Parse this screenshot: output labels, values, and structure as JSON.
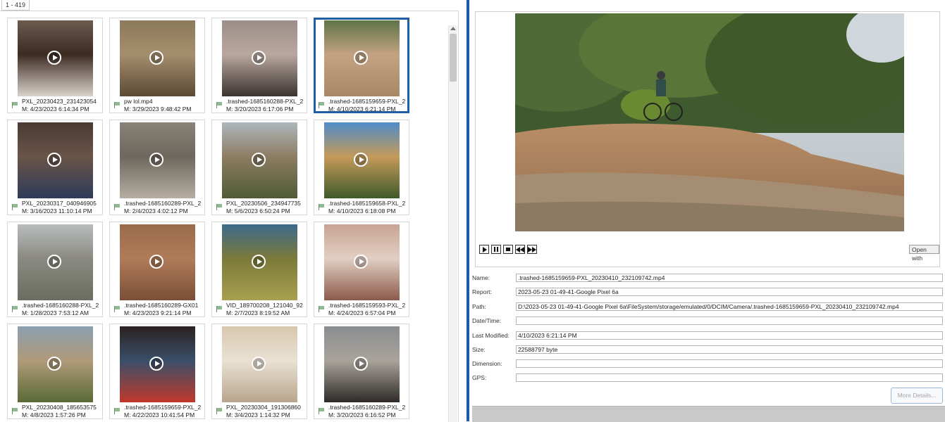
{
  "gallery": {
    "range_label": "1 - 419",
    "tiles": [
      {
        "name": "PXL_20230423_231423054",
        "date": "M: 4/23/2023 6:14:34 PM",
        "selected": false,
        "colors": [
          "#6b5a4e",
          "#d9d3cb",
          "#3d2b22"
        ]
      },
      {
        "name": "pw lol.mp4",
        "date": "M: 3/29/2023 9:48:42 PM",
        "selected": false,
        "colors": [
          "#8c7a5a",
          "#5c4a35",
          "#a58e6e"
        ]
      },
      {
        "name": ".trashed-1685160288-PXL_2",
        "date": "M: 3/20/2023 6:17:06 PM",
        "selected": false,
        "colors": [
          "#9c8f88",
          "#3b3330",
          "#b8a79e"
        ]
      },
      {
        "name": ".trashed-1685159659-PXL_2",
        "date": "M: 4/10/2023 6:21:14 PM",
        "selected": true,
        "colors": [
          "#5f7347",
          "#a78766",
          "#c4a383"
        ]
      },
      {
        "name": "PXL_20230317_040946905",
        "date": "M: 3/16/2023 11:10:14 PM",
        "selected": false,
        "colors": [
          "#4a3a33",
          "#2f3b5a",
          "#6a5448"
        ]
      },
      {
        "name": ".trashed-1685160289-PXL_2",
        "date": "M: 2/4/2023 4:02:12 PM",
        "selected": false,
        "colors": [
          "#8a8377",
          "#b5aea1",
          "#6d675d"
        ]
      },
      {
        "name": "PXL_20230506_234947735",
        "date": "M: 5/6/2023 6:50:24 PM",
        "selected": false,
        "colors": [
          "#aeb6bd",
          "#4f5a35",
          "#8c7d62"
        ]
      },
      {
        "name": ".trashed-1685159658-PXL_2",
        "date": "M: 4/10/2023 6:18:08 PM",
        "selected": false,
        "colors": [
          "#4f8cc9",
          "#3e5a2a",
          "#c59a5a"
        ]
      },
      {
        "name": ".trashed-1685160288-PXL_2",
        "date": "M: 1/28/2023 7:53:12 AM",
        "selected": false,
        "colors": [
          "#b9bcbd",
          "#6a6d5f",
          "#8a8a82"
        ]
      },
      {
        "name": ".trashed-1685160289-GX01",
        "date": "M: 4/23/2023 9:21:14 PM",
        "selected": false,
        "colors": [
          "#9a6b4b",
          "#7a4f37",
          "#b07c58"
        ]
      },
      {
        "name": "VID_189700208_121040_92",
        "date": "M: 2/7/2023 8:19:52 AM",
        "selected": false,
        "colors": [
          "#3c6a8a",
          "#a7a14f",
          "#7c7a3a"
        ]
      },
      {
        "name": ".trashed-1685159593-PXL_2",
        "date": "M: 4/24/2023 6:57:04 PM",
        "selected": false,
        "colors": [
          "#c8a393",
          "#8a5a4a",
          "#e2cfc3"
        ]
      },
      {
        "name": "PXL_20230408_185653575",
        "date": "M: 4/8/2023 1:57:26 PM",
        "selected": false,
        "colors": [
          "#8aa0b0",
          "#5a6a35",
          "#b09a7a"
        ]
      },
      {
        "name": ".trashed-1685159659-PXL_2",
        "date": "M: 4/22/2023 10:41:54 PM",
        "selected": false,
        "colors": [
          "#2a2220",
          "#c0392b",
          "#3a4f6a"
        ]
      },
      {
        "name": "PXL_20230304_191306860",
        "date": "M: 3/4/2023 1:14:32 PM",
        "selected": false,
        "colors": [
          "#d8c7ae",
          "#b9a58d",
          "#e9e1d4"
        ]
      },
      {
        "name": ".trashed-1685160289-PXL_2",
        "date": "M: 3/20/2023 6:16:52 PM",
        "selected": false,
        "colors": [
          "#8a8d8f",
          "#2e2a28",
          "#a9a39c"
        ]
      }
    ]
  },
  "player": {
    "open_with_label": "Open with",
    "controls": [
      "play-icon",
      "pause-icon",
      "stop-icon",
      "rewind-icon",
      "fast-forward-icon"
    ]
  },
  "properties": {
    "labels": {
      "name": "Name:",
      "report": "Report:",
      "path": "Path:",
      "datetime": "Date/Time:",
      "last_modified": "Last Modified:",
      "size": "Size:",
      "dimension": "Dimension:",
      "gps": "GPS:"
    },
    "values": {
      "name": ".trashed-1685159659-PXL_20230410_232109742.mp4",
      "report": "2023-05-23 01-49-41-Google Pixel 6a",
      "path": "D:\\2023-05-23 01-49-41-Google Pixel 6a\\FileSystem/storage/emulated/0/DCIM/Camera/.trashed-1685159659-PXL_20230410_232109742.mp4",
      "datetime": "",
      "last_modified": "4/10/2023 6:21:14 PM",
      "size": "22588797 byte",
      "dimension": "",
      "gps": ""
    },
    "more_details_label": "More Details..."
  },
  "colors": {
    "selection": "#1f5fa6",
    "splitter": "#1b5aa8"
  }
}
